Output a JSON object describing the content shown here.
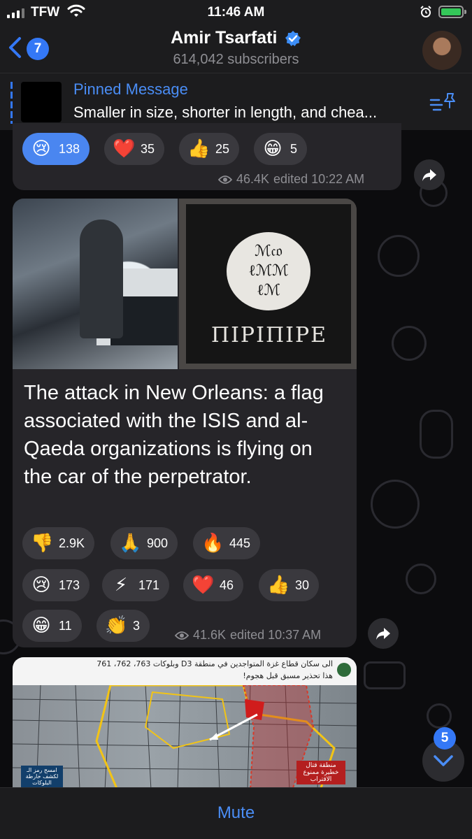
{
  "status_bar": {
    "carrier": "TFW",
    "time": "11:46 AM"
  },
  "header": {
    "back_count": "7",
    "title": "Amir Tsarfati",
    "subscribers": "614,042 subscribers"
  },
  "pinned": {
    "title": "Pinned Message",
    "text": "Smaller in size, shorter in length, and chea..."
  },
  "message1": {
    "reactions": [
      {
        "emoji": "😢",
        "count": "138",
        "active": true
      },
      {
        "emoji": "❤️",
        "count": "35",
        "active": false
      },
      {
        "emoji": "👍",
        "count": "25",
        "active": false
      },
      {
        "emoji": "😁",
        "count": "5",
        "active": false
      }
    ],
    "views": "46.4K",
    "edited": "edited 10:22 AM"
  },
  "message2": {
    "flag_text": "ΠΙΡΙΠΙΡΕ",
    "text": "The attack in New Orleans: a flag associated with the ISIS and al-Qaeda organizations is flying on the car of the perpetrator.",
    "reactions": [
      {
        "emoji": "👎",
        "count": "2.9K"
      },
      {
        "emoji": "🙏",
        "count": "900"
      },
      {
        "emoji": "🔥",
        "count": "445"
      },
      {
        "emoji": "😢",
        "count": "173"
      },
      {
        "emoji": "⚡",
        "count": "171"
      },
      {
        "emoji": "❤️",
        "count": "46"
      },
      {
        "emoji": "👍",
        "count": "30"
      },
      {
        "emoji": "😁",
        "count": "11"
      },
      {
        "emoji": "👏",
        "count": "3"
      }
    ],
    "views": "41.6K",
    "edited": "edited 10:37 AM"
  },
  "message3": {
    "map_header_line1": "الى سكان قطاع غزة المتواجدين في منطقة D3 وبلوكات 763، 762، 761",
    "map_header_line2": "هذا تحذير مسبق قبل هجوم!",
    "map_red_label": "منطقة قتال خطيرة ممنوع الاقتراب",
    "map_blue_label": "امسح رمز الـ لكشف خارطة البلوكات"
  },
  "scroll_badge": "5",
  "bottom": {
    "mute_label": "Mute"
  },
  "colors": {
    "accent": "#3478f6",
    "link": "#4a8df5",
    "bubble": "#262529",
    "bar": "#1c1c1e"
  }
}
